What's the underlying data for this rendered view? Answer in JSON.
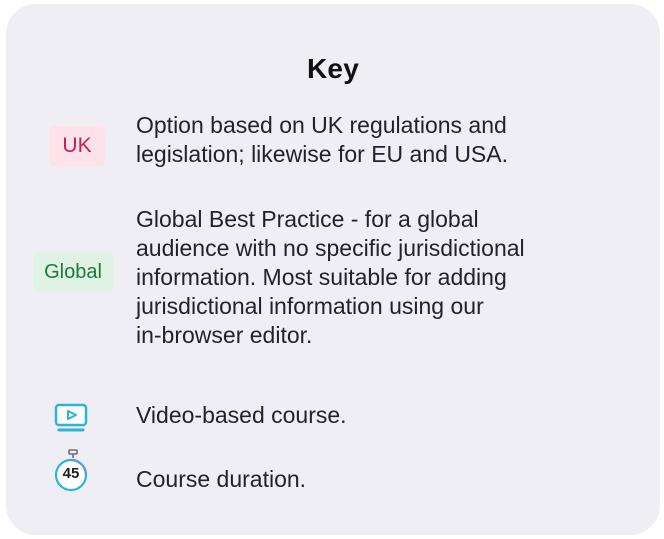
{
  "key": {
    "title": "Key",
    "items": [
      {
        "icon": "uk-badge",
        "badge": "UK",
        "lines": [
          "Option based on UK regulations and",
          "legislation; likewise for EU and USA."
        ]
      },
      {
        "icon": "global-badge",
        "badge": "Global",
        "lines": [
          "Global Best Practice - for a global",
          "audience with no specific jurisdictional",
          "information. Most suitable for adding",
          "jurisdictional information using our",
          "in-browser editor."
        ]
      },
      {
        "icon": "video-icon",
        "lines": [
          "Video-based course."
        ]
      },
      {
        "icon": "timer-icon",
        "icon_text": "45",
        "lines": [
          "Course duration."
        ]
      }
    ]
  },
  "colors": {
    "card_bg": "#efeef4",
    "uk_badge_bg": "#fde2ea",
    "uk_badge_text": "#c2205b",
    "global_badge_bg": "#dff2e3",
    "global_badge_text": "#1e7a3a",
    "video_icon": "#2cb3d6"
  }
}
